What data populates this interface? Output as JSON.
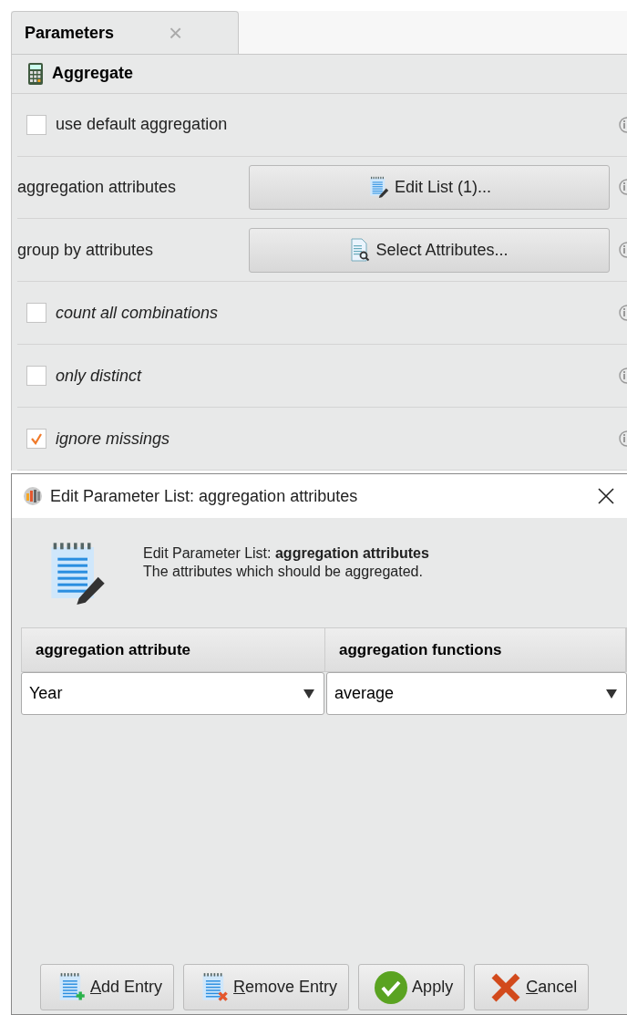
{
  "panel": {
    "tab": {
      "label": "Parameters",
      "close": "×",
      "selected": true
    },
    "operator": "Aggregate",
    "parameters": [
      {
        "kind": "checkbox",
        "label": "use default aggregation",
        "checked": false,
        "italic": false
      },
      {
        "kind": "list",
        "label": "aggregation attributes",
        "button": "Edit List (1)..."
      },
      {
        "kind": "select",
        "label": "group by attributes",
        "button": "Select Attributes..."
      },
      {
        "kind": "checkbox",
        "label": "count all combinations",
        "checked": false,
        "italic": true
      },
      {
        "kind": "checkbox",
        "label": "only distinct",
        "checked": false,
        "italic": true
      },
      {
        "kind": "checkbox",
        "label": "ignore missings",
        "checked": true,
        "italic": true
      }
    ]
  },
  "dialog": {
    "title": "Edit Parameter List: aggregation attributes",
    "heading": "Edit Parameter List: **aggregation attributes**",
    "description": "The attributes which should be aggregated.",
    "columns": [
      "aggregation attribute",
      "aggregation functions"
    ],
    "rows": [
      {
        "cells": [
          "Year",
          "average"
        ]
      }
    ],
    "buttons": [
      {
        "kind": "add",
        "label": "Add Entry",
        "underlined": true
      },
      {
        "kind": "remove",
        "label": "Remove Entry",
        "underlined": true
      },
      {
        "kind": "apply",
        "label": "Apply",
        "underlined": false
      },
      {
        "kind": "cancel",
        "label": "Cancel",
        "underlined": true
      }
    ]
  }
}
